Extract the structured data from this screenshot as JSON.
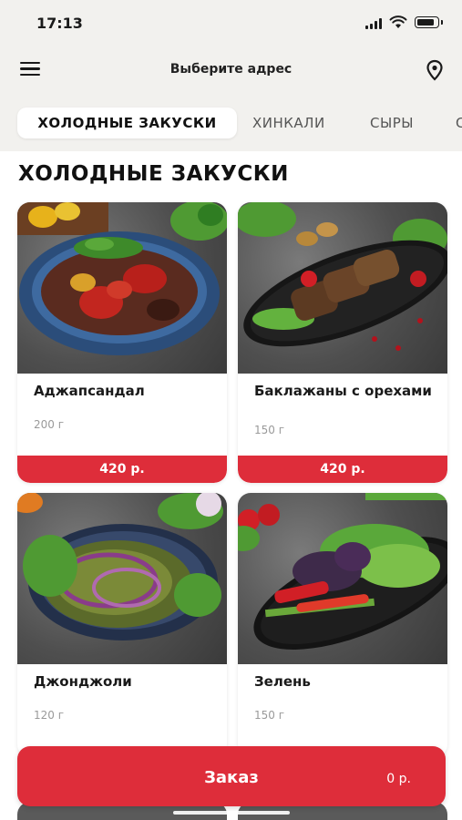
{
  "status_bar": {
    "time": "17:13"
  },
  "header": {
    "address_prompt": "Выберите адрес"
  },
  "tabs": [
    {
      "label": "ХОЛОДНЫЕ ЗАКУСКИ",
      "active": true
    },
    {
      "label": "ХИНКАЛИ",
      "active": false
    },
    {
      "label": "СЫРЫ",
      "active": false
    },
    {
      "label": "С",
      "active": false
    }
  ],
  "section": {
    "title": "ХОЛОДНЫЕ ЗАКУСКИ"
  },
  "products": [
    {
      "name": "Аджапсандал",
      "weight": "200 г",
      "price": "420 р."
    },
    {
      "name": "Баклажаны с орехами",
      "weight": "150 г",
      "price": "420 р."
    },
    {
      "name": "Джонджоли",
      "weight": "120 г",
      "price": ""
    },
    {
      "name": "Зелень",
      "weight": "150 г",
      "price": ""
    }
  ],
  "order_bar": {
    "label": "Заказ",
    "total": "0 р."
  },
  "colors": {
    "accent": "#de2d3a",
    "header_bg": "#f2f1ee",
    "text": "#1a1a1a",
    "muted": "#9a9a9a"
  },
  "icons": [
    "menu-icon",
    "location-pin-icon",
    "signal-icon",
    "wifi-icon",
    "battery-icon"
  ]
}
